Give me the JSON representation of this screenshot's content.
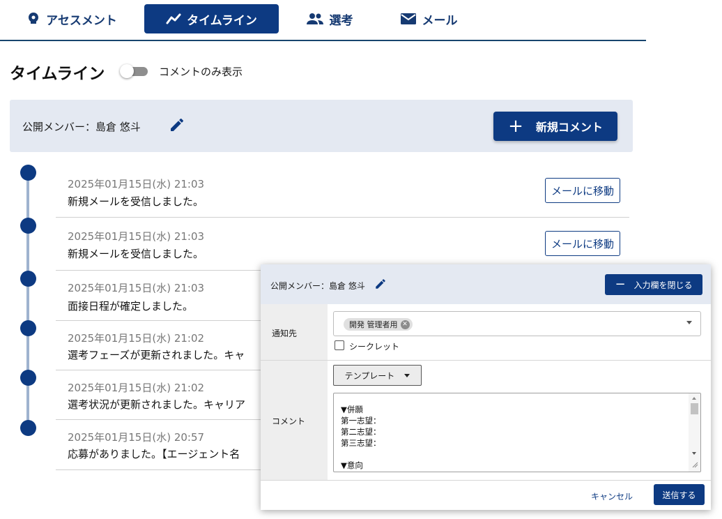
{
  "tabs": [
    {
      "label": "アセスメント",
      "icon": "assessment-icon",
      "active": false
    },
    {
      "label": "タイムライン",
      "icon": "timeline-icon",
      "active": true
    },
    {
      "label": "選考",
      "icon": "people-icon",
      "active": false
    },
    {
      "label": "メール",
      "icon": "mail-icon",
      "active": false
    }
  ],
  "page": {
    "title": "タイムライン",
    "toggle_label": "コメントのみ表示",
    "toggle_on": false
  },
  "member_bar": {
    "text": "公開メンバー：島倉 悠斗",
    "new_comment_label": "新規コメント"
  },
  "timeline": [
    {
      "date": "2025年01月15日(水) 21:03",
      "message": "新規メールを受信しました。",
      "action": "メールに移動"
    },
    {
      "date": "2025年01月15日(水) 21:03",
      "message": "新規メールを受信しました。",
      "action": "メールに移動"
    },
    {
      "date": "2025年01月15日(水) 21:03",
      "message": "面接日程が確定しました。"
    },
    {
      "date": "2025年01月15日(水) 21:02",
      "message": "選考フェーズが更新されました。キャ"
    },
    {
      "date": "2025年01月15日(水) 21:02",
      "message": "選考状況が更新されました。キャリア"
    },
    {
      "date": "2025年01月15日(水) 20:57",
      "message": "応募がありました。【エージェント名"
    }
  ],
  "panel": {
    "member_text": "公開メンバー：島倉 悠斗",
    "close_label": "入力欄を閉じる",
    "notify_label": "通知先",
    "notify_chip": "開発 管理者用",
    "secret_label": "シークレット",
    "secret_checked": false,
    "comment_label": "コメント",
    "template_label": "テンプレート",
    "comment_text": "▼併願\n第一志望：\n第二志望：\n第三志望：\n\n▼意向\n予備確度：○%",
    "cancel_label": "キャンセル",
    "send_label": "送信する"
  },
  "colors": {
    "primary": "#0d3a82",
    "member_bar_bg": "#e4e9f2",
    "timeline_line": "#9fb3cf",
    "date_text": "#777777"
  }
}
